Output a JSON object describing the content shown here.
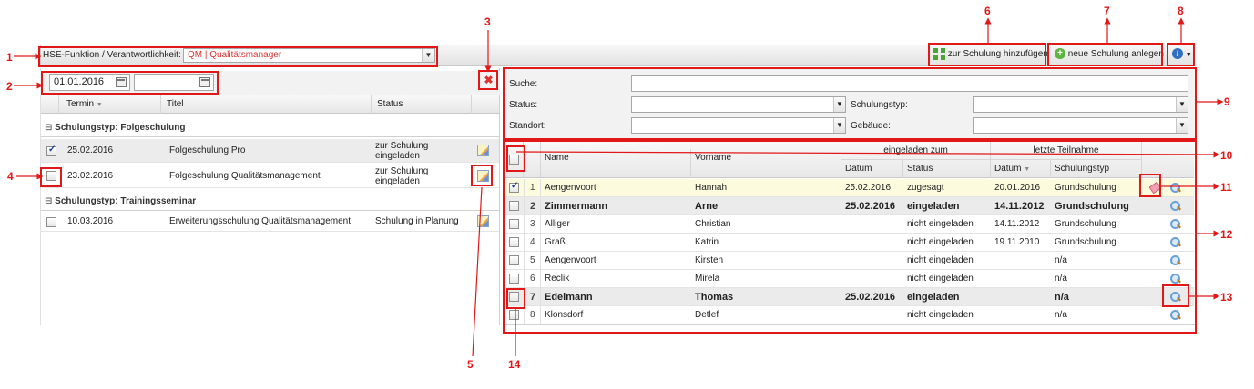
{
  "toolbar": {
    "hse_label": "HSE-Funktion / Verantwortlichkeit:",
    "hse_value": "QM | Qualitätsmanager",
    "add_to_training": "zur Schulung hinzufügen",
    "new_training": "neue Schulung anlegen",
    "info_icon": "info-icon"
  },
  "date_filter": {
    "from": "01.01.2016",
    "to": ""
  },
  "left_grid": {
    "columns": [
      "Termin",
      "Titel",
      "Status"
    ],
    "groups": [
      {
        "label": "Schulungstyp: Folgeschulung",
        "rows": [
          {
            "checked": true,
            "date": "25.02.2016",
            "title": "Folgeschulung Pro",
            "status": "zur Schulung eingeladen"
          },
          {
            "checked": false,
            "date": "23.02.2016",
            "title": "Folgeschulung Qualitätsmanagement",
            "status": "zur Schulung eingeladen"
          }
        ]
      },
      {
        "label": "Schulungstyp: Trainingsseminar",
        "rows": [
          {
            "checked": false,
            "date": "10.03.2016",
            "title": "Erweiterungsschulung Qualitätsmanagement",
            "status": "Schulung in Planung"
          }
        ]
      }
    ]
  },
  "filters": {
    "search_label": "Suche:",
    "status_label": "Status:",
    "type_label": "Schulungstyp:",
    "location_label": "Standort:",
    "building_label": "Gebäude:"
  },
  "right_grid": {
    "headers": {
      "name": "Name",
      "vorname": "Vorname",
      "invited_group": "eingeladen zum",
      "last_group": "letzte Teilnahme",
      "datum": "Datum",
      "status": "Status",
      "datum2": "Datum",
      "typ": "Schulungstyp"
    },
    "rows": [
      {
        "n": "1",
        "name": "Aengenvoort",
        "vorname": "Hannah",
        "datum": "25.02.2016",
        "status": "zugesagt",
        "last_date": "20.01.2016",
        "typ": "Grundschulung",
        "checked": true,
        "bold": false
      },
      {
        "n": "2",
        "name": "Zimmermann",
        "vorname": "Arne",
        "datum": "25.02.2016",
        "status": "eingeladen",
        "last_date": "14.11.2012",
        "typ": "Grundschulung",
        "checked": false,
        "bold": true
      },
      {
        "n": "3",
        "name": "Alliger",
        "vorname": "Christian",
        "datum": "",
        "status": "nicht eingeladen",
        "last_date": "14.11.2012",
        "typ": "Grundschulung",
        "checked": false,
        "bold": false
      },
      {
        "n": "4",
        "name": "Graß",
        "vorname": "Katrin",
        "datum": "",
        "status": "nicht eingeladen",
        "last_date": "19.11.2010",
        "typ": "Grundschulung",
        "checked": false,
        "bold": false
      },
      {
        "n": "5",
        "name": "Aengenvoort",
        "vorname": "Kirsten",
        "datum": "",
        "status": "nicht eingeladen",
        "last_date": "",
        "typ": "n/a",
        "checked": false,
        "bold": false
      },
      {
        "n": "6",
        "name": "Reclik",
        "vorname": "Mirela",
        "datum": "",
        "status": "nicht eingeladen",
        "last_date": "",
        "typ": "n/a",
        "checked": false,
        "bold": false
      },
      {
        "n": "7",
        "name": "Edelmann",
        "vorname": "Thomas",
        "datum": "25.02.2016",
        "status": "eingeladen",
        "last_date": "",
        "typ": "n/a",
        "checked": false,
        "bold": true
      },
      {
        "n": "8",
        "name": "Klonsdorf",
        "vorname": "Detlef",
        "datum": "",
        "status": "nicht eingeladen",
        "last_date": "",
        "typ": "n/a",
        "checked": false,
        "bold": false
      }
    ]
  },
  "callouts": [
    "1",
    "2",
    "3",
    "4",
    "5",
    "6",
    "7",
    "8",
    "9",
    "10",
    "11",
    "12",
    "13",
    "14"
  ],
  "colors": {
    "annotation": "#e01818",
    "selected_row": "#fcfbde",
    "bold_row": "#ebebeb"
  }
}
